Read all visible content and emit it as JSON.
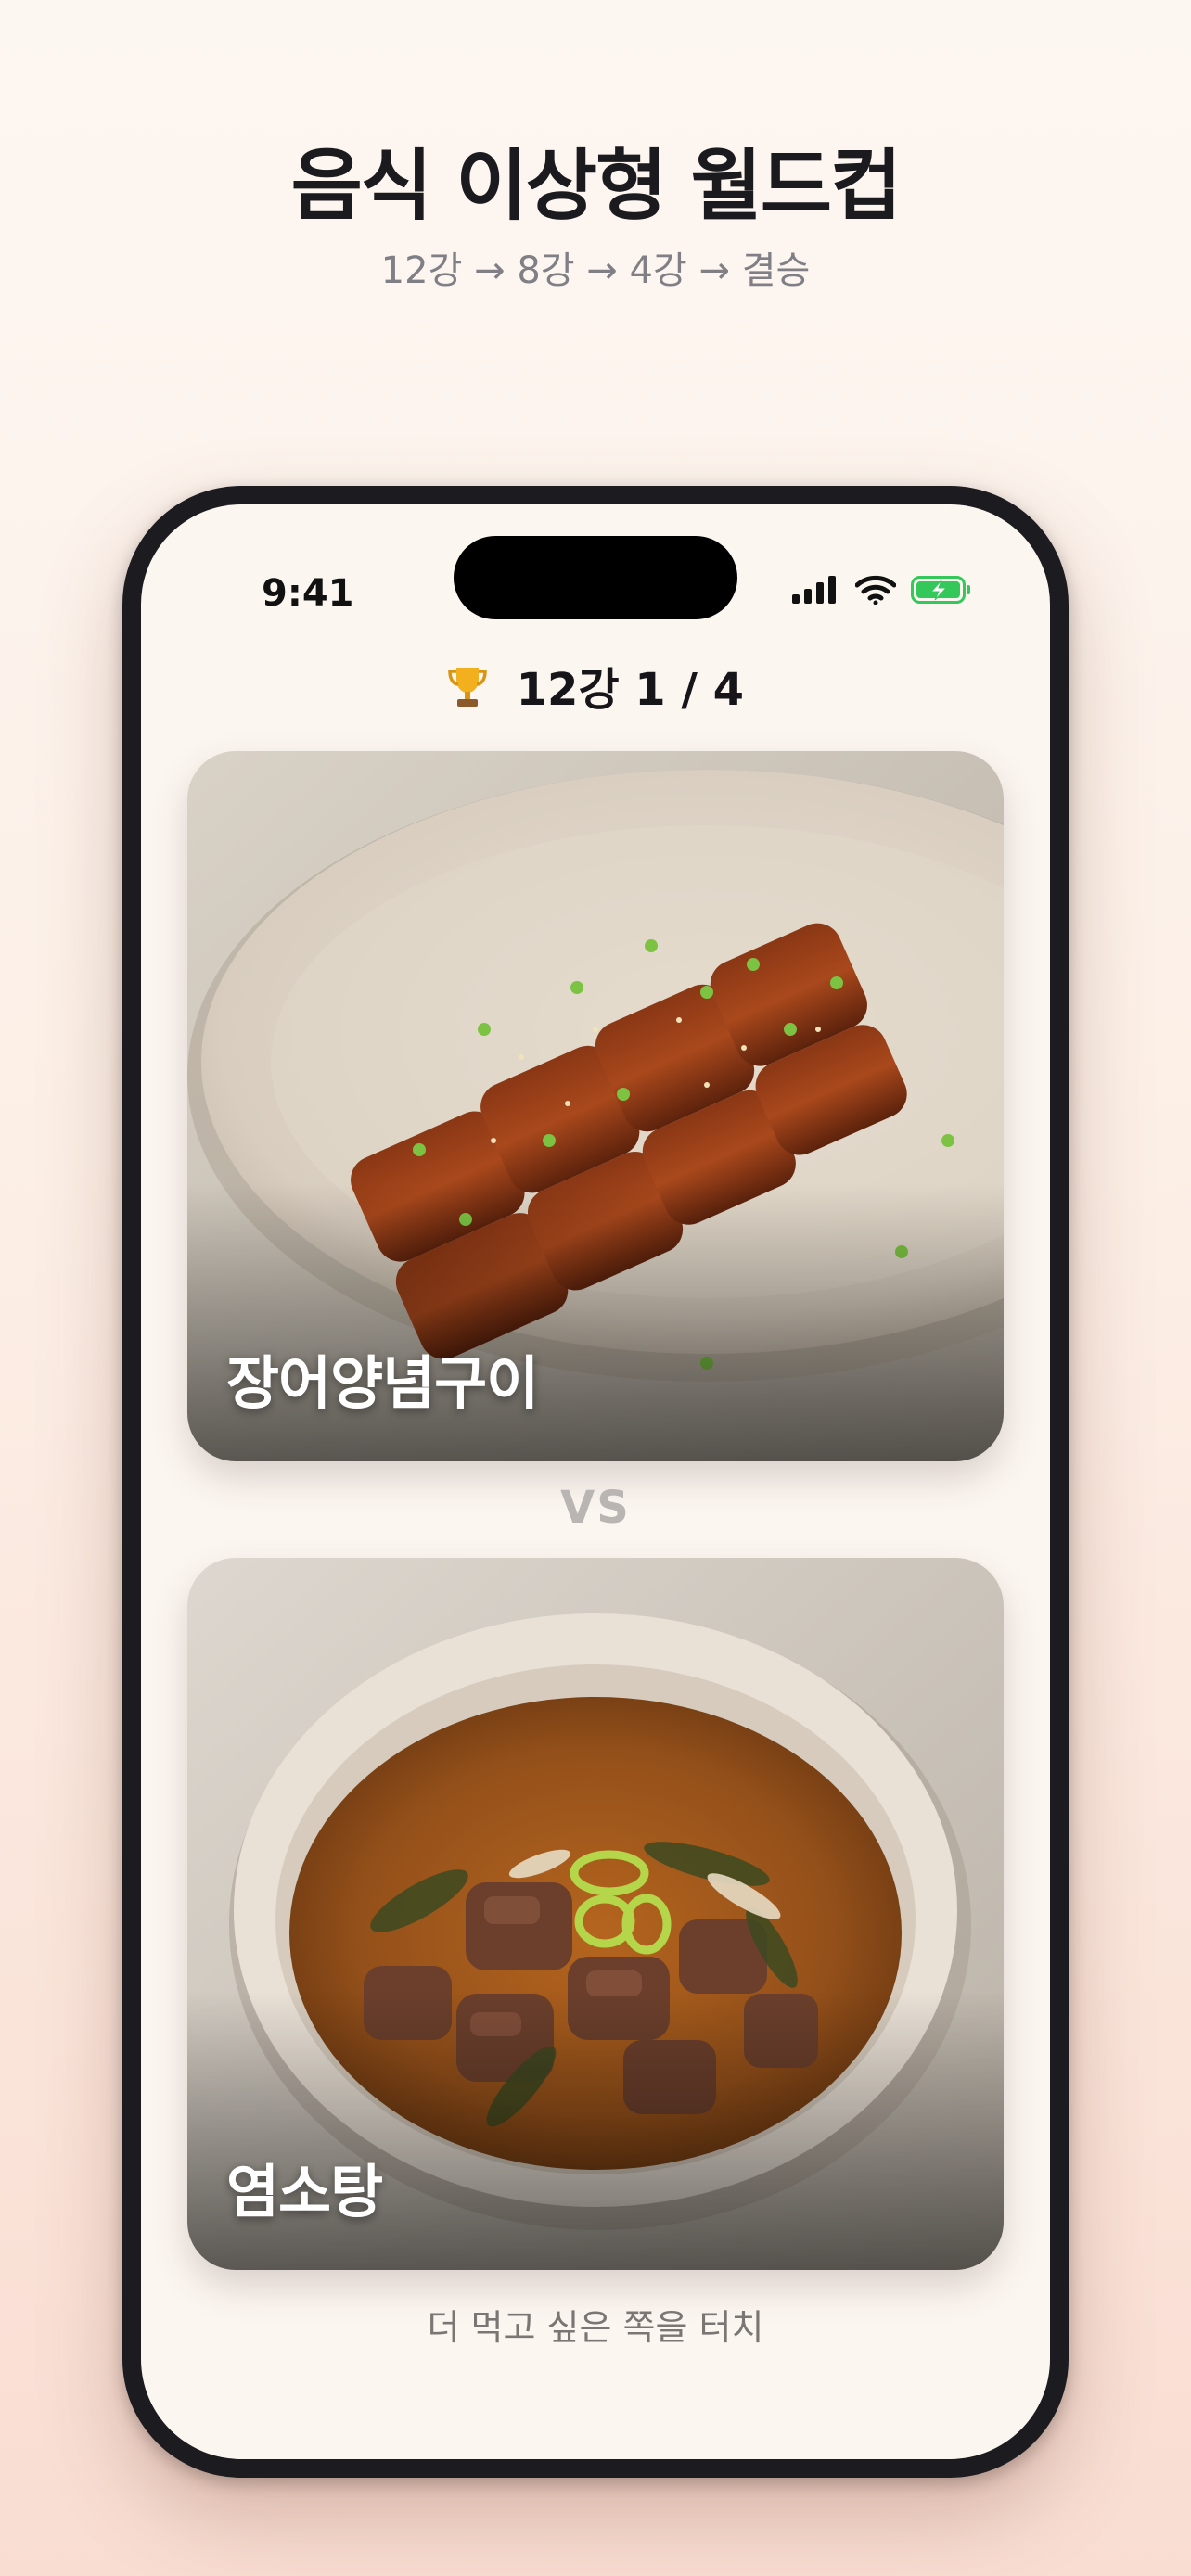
{
  "promo": {
    "title": "음식 이상형 월드컵",
    "subtitle": "12강 → 8강 → 4강 → 결승"
  },
  "status_bar": {
    "time": "9:41",
    "icons": [
      "cellular-signal-icon",
      "wifi-icon",
      "battery-charging-icon"
    ],
    "battery_color": "#34c759"
  },
  "game": {
    "round_label": "12강 1 / 4",
    "trophy_icon": "trophy-icon",
    "vs_label": "VS",
    "hint": "더 먹고 싶은 쪽을 터치"
  },
  "candidates": [
    {
      "name": "장어양념구이",
      "image": "grilled-eel-photo"
    },
    {
      "name": "염소탕",
      "image": "goat-stew-photo"
    }
  ],
  "colors": {
    "background_top": "#fdf7f2",
    "background_bottom": "#f9ddd2",
    "phone_frame": "#1c1b20",
    "screen": "#fcf6f1"
  }
}
